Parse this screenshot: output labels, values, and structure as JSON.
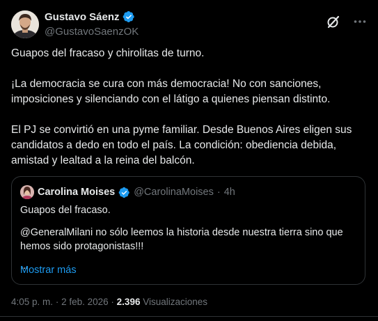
{
  "tweet": {
    "author_name": "Gustavo Sáenz",
    "author_handle": "@GustavoSaenzOK",
    "paragraphs": [
      "Guapos del fracaso y chirolitas de turno.",
      "¡La democracia se cura con más democracia! No con sanciones, imposiciones y silenciando con el látigo a quienes piensan distinto.",
      "El PJ se convirtió en una pyme familiar. Desde Buenos Aires eligen sus candidatos a dedo en todo el país. La condición: obediencia debida, amistad y lealtad a la reina del balcón."
    ],
    "time": "4:05 p. m.",
    "separator": "·",
    "date": "2 feb. 2026",
    "views_count": "2.396",
    "views_label": "Visualizaciones"
  },
  "quote": {
    "author_name": "Carolina Moises",
    "author_handle": "@CarolinaMoises",
    "separator": "·",
    "time_ago": "4h",
    "line1": "Guapos del fracaso.",
    "line2": "@GeneralMilani no sólo leemos la historia desde nuestra tierra sino que hemos sido protagonistas!!!",
    "ellipsis": "...",
    "show_more": "Mostrar más"
  },
  "icons": {
    "verified": "verified-badge-icon",
    "grok": "grok-icon",
    "more": "more-options-icon"
  },
  "colors": {
    "background": "#000000",
    "text": "#e7e9ea",
    "secondary": "#71767b",
    "accent": "#1d9bf0",
    "border": "#2f3336"
  }
}
